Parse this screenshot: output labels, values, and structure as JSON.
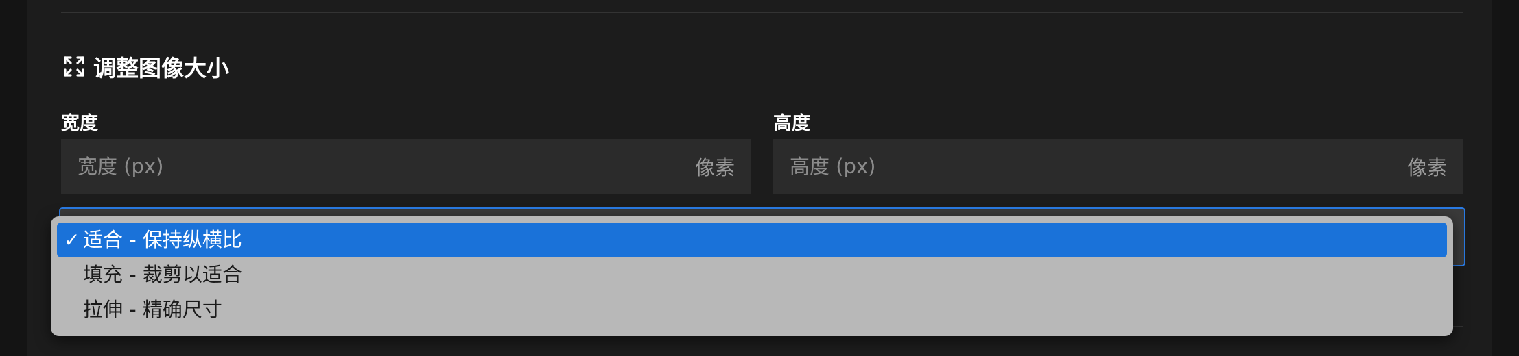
{
  "resize_section": {
    "title": "调整图像大小",
    "icon": "expand-icon"
  },
  "width_field": {
    "label": "宽度",
    "placeholder": "宽度 (px)",
    "value": "",
    "unit": "像素"
  },
  "height_field": {
    "label": "高度",
    "placeholder": "高度 (px)",
    "value": "",
    "unit": "像素"
  },
  "fit_mode_select": {
    "selected_index": 0,
    "check_glyph": "✓",
    "options": [
      {
        "label": "适合 - 保持纵横比"
      },
      {
        "label": "填充 - 裁剪以适合"
      },
      {
        "label": "拉伸 - 精确尺寸"
      }
    ]
  },
  "colors": {
    "background": "#1c1c1c",
    "input_background": "#2b2b2b",
    "accent": "#1a72d9",
    "dropdown_background": "#b8b8b8"
  }
}
